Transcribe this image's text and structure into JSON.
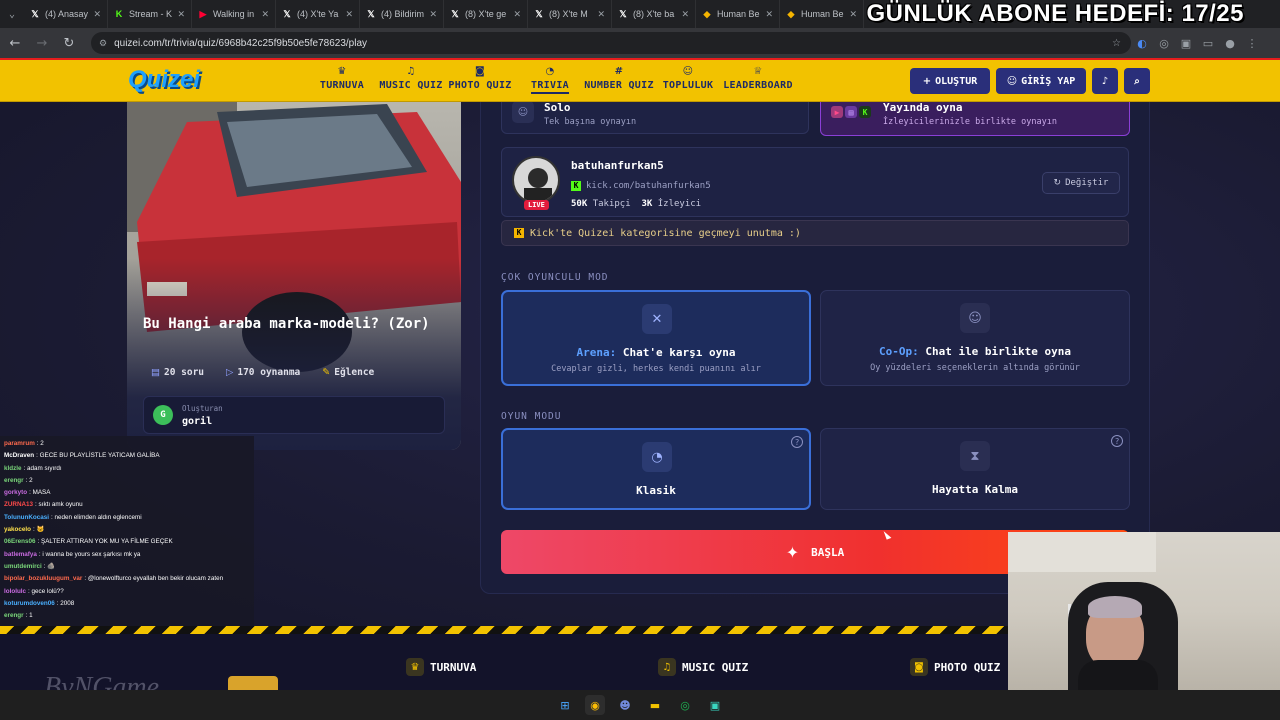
{
  "browser": {
    "tabs": [
      {
        "title": "(4) Anasay",
        "icon": "x-icon",
        "color": "#ffffff"
      },
      {
        "title": "Stream - K",
        "icon": "kick-icon",
        "color": "#53fc18"
      },
      {
        "title": "Walking in",
        "icon": "youtube-icon",
        "color": "#ff0033"
      },
      {
        "title": "(4) X'te Ya",
        "icon": "x-icon",
        "color": "#ffffff"
      },
      {
        "title": "(4) Bildirim",
        "icon": "x-icon",
        "color": "#ffffff"
      },
      {
        "title": "(8) X'te ge",
        "icon": "x-icon",
        "color": "#ffffff"
      },
      {
        "title": "(8) X'te M",
        "icon": "x-icon",
        "color": "#ffffff"
      },
      {
        "title": "(8) X'te ba",
        "icon": "x-icon",
        "color": "#ffffff"
      },
      {
        "title": "Human Be",
        "icon": "bookmark-icon",
        "color": "#f4b400"
      },
      {
        "title": "Human Be",
        "icon": "bookmark-icon",
        "color": "#f4b400"
      }
    ],
    "url": "quizei.com/tr/trivia/quiz/6968b42c25f9b50e5fe78623/play",
    "overlay_text": "GÜNLÜK ABONE HEDEFİ: 17/25"
  },
  "site": {
    "logo": "Quizei",
    "nav": [
      {
        "label": "TURNUVA",
        "icon": "trophy-icon",
        "glyph": "♛"
      },
      {
        "label": "MUSIC QUIZ",
        "icon": "music-icon",
        "glyph": "♫"
      },
      {
        "label": "PHOTO QUIZ",
        "icon": "camera-icon",
        "glyph": "◙"
      },
      {
        "label": "TRIVIA",
        "icon": "chat-icon",
        "glyph": "◔"
      },
      {
        "label": "NUMBER QUIZ",
        "icon": "hash-icon",
        "glyph": "#"
      },
      {
        "label": "TOPLULUK",
        "icon": "users-icon",
        "glyph": "☺"
      },
      {
        "label": "LEADERBOARD",
        "icon": "medal-icon",
        "glyph": "♕"
      }
    ],
    "create_label": "OLUŞTUR",
    "login_label": "GİRİŞ YAP"
  },
  "quiz": {
    "title": "Bu Hangi araba marka-modeli? (Zor)",
    "questions": "20 soru",
    "plays": "170 oynanma",
    "category": "Eğlence",
    "creator_label": "Oluşturan",
    "creator_name": "goril",
    "creator_initial": "G"
  },
  "panel": {
    "solo_title": "Solo",
    "solo_sub": "Tek başına oynayın",
    "live_title": "Yayında oyna",
    "live_sub": "İzleyicilerinizle birlikte oynayın",
    "streamer_name": "batuhanfurkan5",
    "streamer_url": "kick.com/batuhanfurkan5",
    "followers": "50K",
    "followers_label": "Takipçi",
    "viewers": "3K",
    "viewers_label": "İzleyici",
    "live_badge": "LIVE",
    "change_label": "Değiştir",
    "tip": "Kick'te Quizei kategorisine geçmeyi unutma :)",
    "multi_label": "ÇOK OYUNCULU MOD",
    "arena_prefix": "Arena:",
    "arena_title": "Chat'e karşı oyna",
    "arena_sub": "Cevaplar gizli, herkes kendi puanını alır",
    "coop_prefix": "Co-Op:",
    "coop_title": "Chat ile birlikte oyna",
    "coop_sub": "Oy yüzdeleri seçeneklerin altında görünür",
    "game_mode_label": "OYUN MODU",
    "classic_label": "Klasik",
    "survival_label": "Hayatta Kalma",
    "start_label": "BAŞLA"
  },
  "chat": [
    {
      "user": "paramrum",
      "msg": ": 2",
      "color": "#ff6a4d"
    },
    {
      "user": "McDraven",
      "msg": ": GECE BU PLAYLİSTLE YATICAM GALİBA",
      "color": "#ffffff"
    },
    {
      "user": "kldzle",
      "msg": ": adam sıyırdı",
      "color": "#7ad67a"
    },
    {
      "user": "erengr",
      "msg": ": 2",
      "color": "#7ad67a"
    },
    {
      "user": "gorkyto",
      "msg": ": MASA",
      "color": "#c96be0"
    },
    {
      "user": "ZURNA13",
      "msg": ": sıktı amk oyunu",
      "color": "#ff4a4a"
    },
    {
      "user": "TolununKocasi",
      "msg": ": neden elimden aldın eglencemi",
      "color": "#4ab0ff"
    },
    {
      "user": "yakocelo",
      "msg": ": 🐱",
      "color": "#ffe14a"
    },
    {
      "user": "06Erens06",
      "msg": ": ŞALTER ATTIRAN YOK MU YA FİLME GEÇEK",
      "color": "#7ad67a"
    },
    {
      "user": "batlemafya",
      "msg": ": i wanna be yours sex şarkısı mk ya",
      "color": "#c96be0"
    },
    {
      "user": "umutdemirci",
      "msg": ": 🪨",
      "color": "#7ad67a"
    },
    {
      "user": "bipolar_bozukluugum_var",
      "msg": ": @lonewolfturco eyvallah ben bekir olucam zaten",
      "color": "#ff6a4d"
    },
    {
      "user": "loIoIulc",
      "msg": ": gece lolü??",
      "color": "#c96be0"
    },
    {
      "user": "koturumdoven06",
      "msg": ": 2008",
      "color": "#4ab0ff"
    },
    {
      "user": "erengr",
      "msg": ": 1",
      "color": "#7ad67a"
    }
  ],
  "footer": {
    "items": [
      "TURNUVA",
      "MUSIC QUIZ",
      "PHOTO QUIZ"
    ],
    "watermark": "ByNGame"
  },
  "colors": {
    "brand_yellow": "#f2c200",
    "nav_text": "#1d2a66",
    "start_gradient_start": "#ee4868",
    "start_gradient_end": "#ff4a10",
    "accent_blue": "#3a6fd8"
  }
}
